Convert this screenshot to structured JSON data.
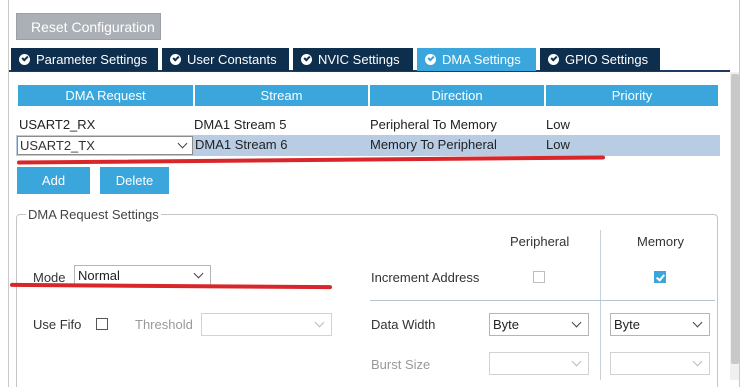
{
  "toolbar": {
    "reset_label": "Reset Configuration"
  },
  "tabs": [
    {
      "label": "Parameter Settings",
      "active": false
    },
    {
      "label": "User Constants",
      "active": false
    },
    {
      "label": "NVIC Settings",
      "active": false
    },
    {
      "label": "DMA Settings",
      "active": true
    },
    {
      "label": "GPIO Settings",
      "active": false
    }
  ],
  "dma_table": {
    "headers": [
      "DMA Request",
      "Stream",
      "Direction",
      "Priority"
    ],
    "rows": [
      {
        "request": "USART2_RX",
        "stream": "DMA1 Stream 5",
        "direction": "Peripheral To Memory",
        "priority": "Low",
        "selected": false
      },
      {
        "request": "USART2_TX",
        "stream": "DMA1 Stream 6",
        "direction": "Memory To Peripheral",
        "priority": "Low",
        "selected": true
      }
    ]
  },
  "buttons": {
    "add": "Add",
    "delete": "Delete"
  },
  "settings": {
    "legend": "DMA Request Settings",
    "col_peripheral": "Peripheral",
    "col_memory": "Memory",
    "mode_label": "Mode",
    "mode_value": "Normal",
    "increment_label": "Increment Address",
    "increment_peripheral": false,
    "increment_memory": true,
    "use_fifo_label": "Use Fifo",
    "use_fifo": false,
    "threshold_label": "Threshold",
    "threshold_value": "",
    "data_width_label": "Data Width",
    "data_width_peripheral": "Byte",
    "data_width_memory": "Byte",
    "burst_size_label": "Burst Size",
    "burst_size_peripheral": "",
    "burst_size_memory": ""
  },
  "colors": {
    "accent": "#3aa6dc",
    "tab_dark": "#0d2e4d",
    "selection": "#b8cce4",
    "annotation_red": "#d9262a"
  },
  "icons": {
    "tab_check": "check-circle-icon",
    "dropdown": "chevron-down-icon"
  }
}
